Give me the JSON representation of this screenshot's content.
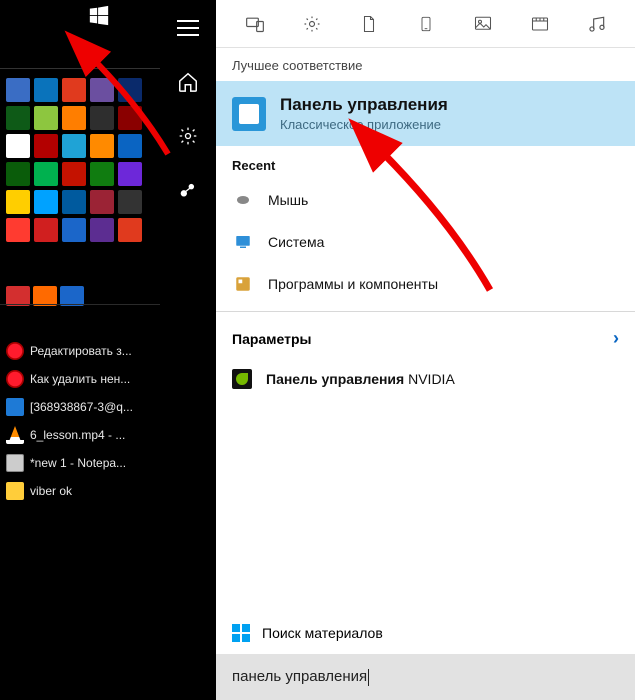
{
  "taskbar": {
    "items": [
      {
        "label": "Редактировать з...",
        "icon": "opera"
      },
      {
        "label": "Как удалить нен...",
        "icon": "opera"
      },
      {
        "label": "[368938867-3@q...",
        "icon": "thunder"
      },
      {
        "label": "6_lesson.mp4 - ...",
        "icon": "vlc"
      },
      {
        "label": "*new 1 - Notepa...",
        "icon": "note"
      },
      {
        "label": "viber ok",
        "icon": "folder"
      }
    ]
  },
  "desktop_icons": [
    "#3a6dc4",
    "#0a73bb",
    "#e03a1e",
    "#6b4fa0",
    "#0a2a6b",
    "#0e5a17",
    "#8dc63f",
    "#ff7e00",
    "#2e2e2e",
    "#8a0000",
    "#ffffff",
    "#b30000",
    "#1fa3d6",
    "#ff8a00",
    "#0a64c2",
    "#0a5c0a",
    "#00b14f",
    "#c41200",
    "#107c10",
    "#6d28d9",
    "#ffce00",
    "#00a2ff",
    "#005a9e",
    "#9b2335",
    "#333333",
    "#ff3b30",
    "#d01f1f",
    "#1b66c9",
    "#5c2d91",
    "#e03a1e"
  ],
  "tray_icons": [
    "#d32f2f",
    "#ff6a00",
    "#1b66c9"
  ],
  "search": {
    "best_match_header": "Лучшее соответствие",
    "best": {
      "title": "Панель управления",
      "subtitle": "Классическое приложение"
    },
    "recent_header": "Recent",
    "recent": [
      {
        "label": "Мышь"
      },
      {
        "label": "Система"
      },
      {
        "label": "Программы и компоненты"
      }
    ],
    "params_header": "Параметры",
    "params_item": {
      "label_bold": "Панель управления",
      "label_rest": " NVIDIA"
    },
    "web_label": "Поиск материалов",
    "query": "панель управления"
  }
}
